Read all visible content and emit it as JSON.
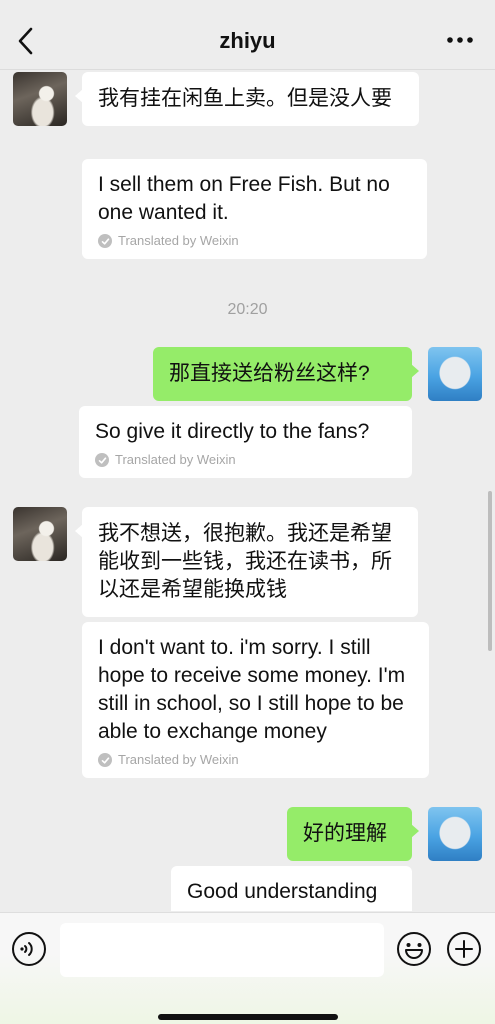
{
  "header": {
    "title": "zhiyu"
  },
  "messages": [
    {
      "side": "left",
      "text": "我有挂在闲鱼上卖。但是没人要",
      "translation": "I sell them on Free Fish. But no one wanted it.",
      "translated_by": "Translated by Weixin"
    },
    {
      "side": "right",
      "text": "那直接送给粉丝这样?",
      "translation": "So give it directly to the fans?",
      "translated_by": "Translated by Weixin"
    },
    {
      "side": "left",
      "text": "我不想送，很抱歉。我还是希望能收到一些钱，我还在读书，所以还是希望能换成钱",
      "translation": "I don't want to. i'm sorry. I still hope to receive some money. I'm still in school, so I still hope to be able to exchange money",
      "translated_by": "Translated by Weixin"
    },
    {
      "side": "right",
      "text": "好的理解",
      "translation": "Good understanding"
    }
  ],
  "timestamp": "20:20",
  "input": {
    "value": "",
    "placeholder": ""
  },
  "icons": {
    "back": "chevron-left-icon",
    "more": "more-dots-icon",
    "voice": "voice-icon",
    "emoji": "emoji-icon",
    "plus": "plus-icon",
    "translated": "check-icon"
  },
  "colors": {
    "background": "#ededed",
    "sent_bubble": "#95ec69",
    "received_bubble": "#ffffff",
    "muted_text": "#a6a6a6"
  }
}
